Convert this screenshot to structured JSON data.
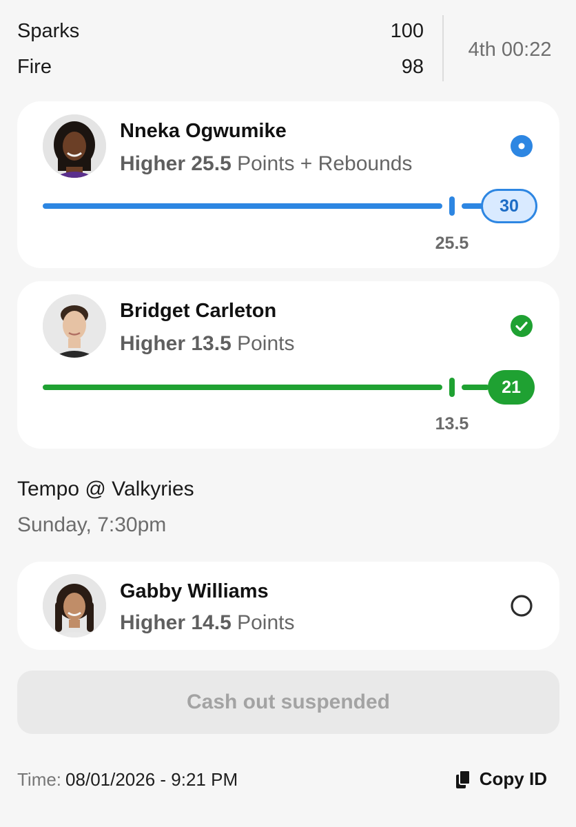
{
  "scoreboard": {
    "teams": [
      {
        "name": "Sparks",
        "score": "100"
      },
      {
        "name": "Fire",
        "score": "98"
      }
    ],
    "clock": "4th 00:22"
  },
  "picks": [
    {
      "player": "Nneka Ogwumike",
      "direction": "Higher",
      "line": "25.5",
      "stat": "Points + Rebounds",
      "current": "30",
      "status": "in-progress",
      "color": "#2d86e2"
    },
    {
      "player": "Bridget Carleton",
      "direction": "Higher",
      "line": "13.5",
      "stat": "Points",
      "current": "21",
      "status": "won",
      "color": "#1fa132"
    }
  ],
  "game": {
    "matchup": "Tempo @ Valkyries",
    "time": "Sunday, 7:30pm"
  },
  "upcoming_pick": {
    "player": "Gabby Williams",
    "direction": "Higher",
    "line": "14.5",
    "stat": "Points",
    "status": "pending"
  },
  "cashout_label": "Cash out suspended",
  "footer": {
    "time_label": "Time:",
    "time_value": "08/01/2026 - 9:21 PM",
    "copy_label": "Copy ID"
  },
  "icons": {
    "status_in_progress": "radio-filled-icon",
    "status_won": "check-circle-icon",
    "status_pending": "radio-empty-icon",
    "copy": "copy-icon"
  }
}
